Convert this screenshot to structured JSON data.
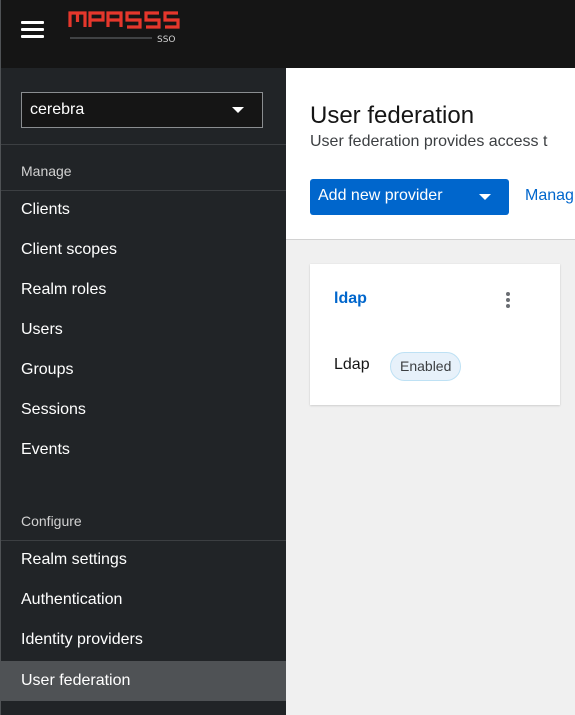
{
  "app": {
    "logo_text": "MPASS",
    "logo_sub": "SSO",
    "logo_color": "#e5372c"
  },
  "sidebar": {
    "realm": "cerebra",
    "sections": [
      {
        "title": "Manage",
        "items": [
          "Clients",
          "Client scopes",
          "Realm roles",
          "Users",
          "Groups",
          "Sessions",
          "Events"
        ]
      },
      {
        "title": "Configure",
        "items": [
          "Realm settings",
          "Authentication",
          "Identity providers",
          "User federation"
        ]
      }
    ],
    "active_item": "User federation"
  },
  "main": {
    "title": "User federation",
    "description": "User federation provides access t",
    "add_button_label": "Add new provider",
    "manage_link": "Manag",
    "card": {
      "title": "ldap",
      "type": "Ldap",
      "status": "Enabled"
    }
  },
  "colors": {
    "primary": "#0066cc",
    "topbar": "#151515",
    "sidebar": "#212427",
    "active_nav": "#4f5255"
  }
}
